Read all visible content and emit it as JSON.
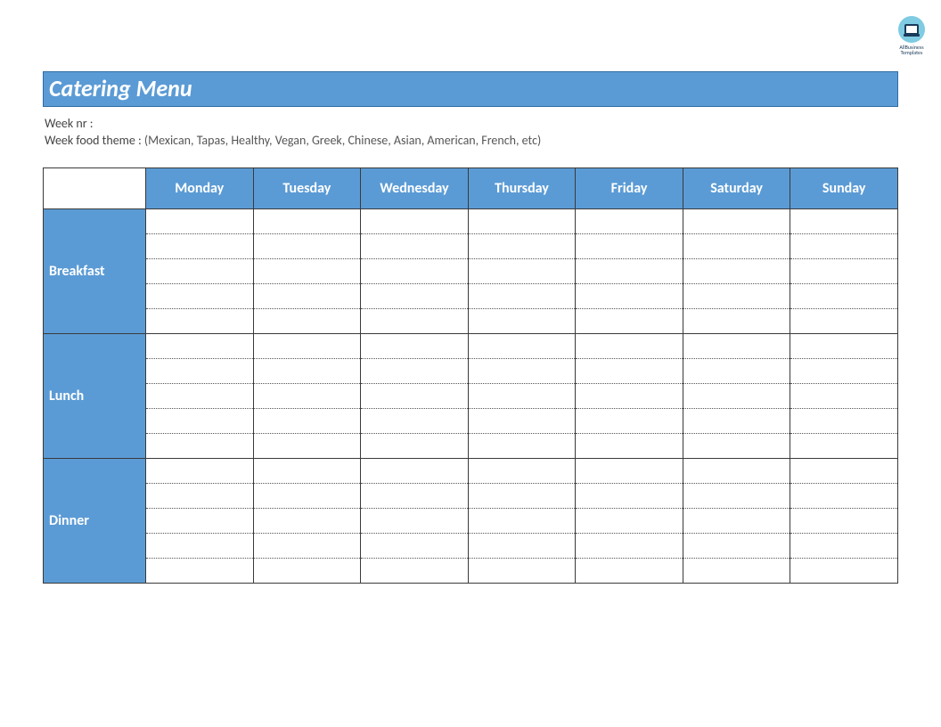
{
  "logo_text": "AllBusiness Templates",
  "title": "Catering Menu",
  "meta": {
    "week_nr_label": "Week nr :",
    "week_nr_value": "",
    "theme_label": "Week food theme :",
    "theme_value": "(Mexican, Tapas, Healthy, Vegan, Greek, Chinese, Asian, American, French, etc)"
  },
  "days": [
    "Monday",
    "Tuesday",
    "Wednesday",
    "Thursday",
    "Friday",
    "Saturday",
    "Sunday"
  ],
  "meals": [
    {
      "name": "Breakfast",
      "rows": 5
    },
    {
      "name": "Lunch",
      "rows": 5
    },
    {
      "name": "Dinner",
      "rows": 5
    }
  ],
  "entries": {
    "Breakfast": {
      "Monday": [
        "",
        "",
        "",
        "",
        ""
      ],
      "Tuesday": [
        "",
        "",
        "",
        "",
        ""
      ],
      "Wednesday": [
        "",
        "",
        "",
        "",
        ""
      ],
      "Thursday": [
        "",
        "",
        "",
        "",
        ""
      ],
      "Friday": [
        "",
        "",
        "",
        "",
        ""
      ],
      "Saturday": [
        "",
        "",
        "",
        "",
        ""
      ],
      "Sunday": [
        "",
        "",
        "",
        "",
        ""
      ]
    },
    "Lunch": {
      "Monday": [
        "",
        "",
        "",
        "",
        ""
      ],
      "Tuesday": [
        "",
        "",
        "",
        "",
        ""
      ],
      "Wednesday": [
        "",
        "",
        "",
        "",
        ""
      ],
      "Thursday": [
        "",
        "",
        "",
        "",
        ""
      ],
      "Friday": [
        "",
        "",
        "",
        "",
        ""
      ],
      "Saturday": [
        "",
        "",
        "",
        "",
        ""
      ],
      "Sunday": [
        "",
        "",
        "",
        "",
        ""
      ]
    },
    "Dinner": {
      "Monday": [
        "",
        "",
        "",
        "",
        ""
      ],
      "Tuesday": [
        "",
        "",
        "",
        "",
        ""
      ],
      "Wednesday": [
        "",
        "",
        "",
        "",
        ""
      ],
      "Thursday": [
        "",
        "",
        "",
        "",
        ""
      ],
      "Friday": [
        "",
        "",
        "",
        "",
        ""
      ],
      "Saturday": [
        "",
        "",
        "",
        "",
        ""
      ],
      "Sunday": [
        "",
        "",
        "",
        "",
        ""
      ]
    }
  }
}
